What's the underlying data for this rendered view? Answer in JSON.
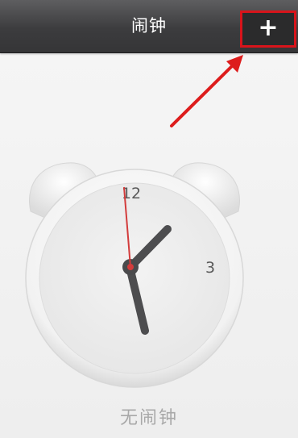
{
  "navbar": {
    "title": "闹钟",
    "add_button_label": "+",
    "add_button_icon": "plus-icon",
    "highlight_color": "#d8141b"
  },
  "clock": {
    "icon": "alarm-clock-icon",
    "label_12": "12",
    "label_3": "3",
    "second_hand_color": "#d33c3c"
  },
  "main": {
    "empty_state_text": "无闹钟"
  }
}
